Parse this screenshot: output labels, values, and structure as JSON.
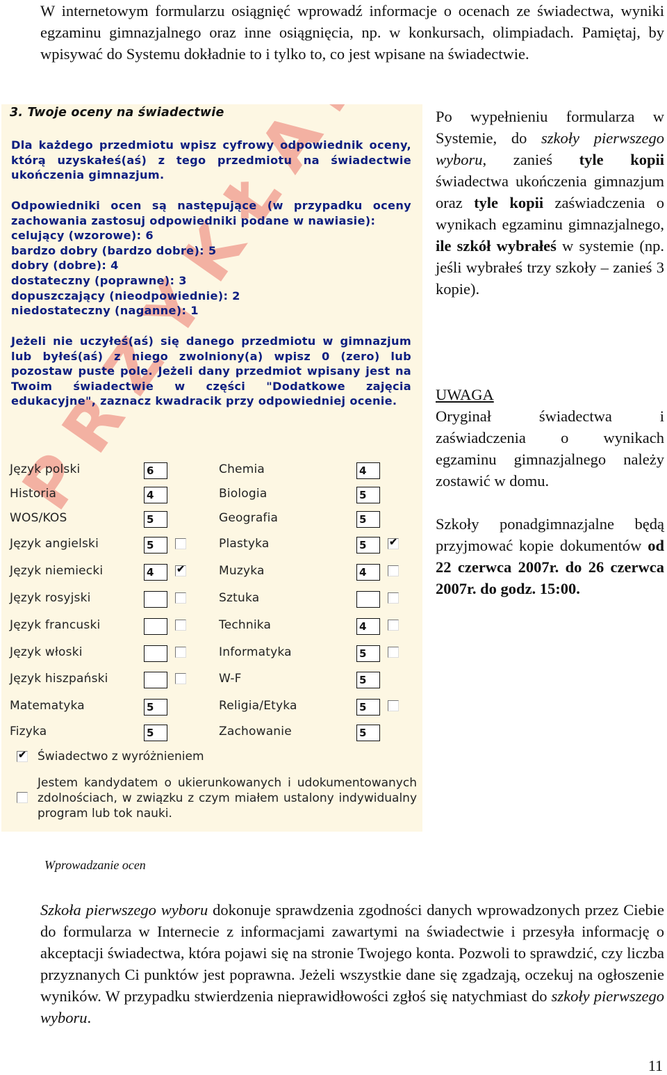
{
  "intro": {
    "text": "W internetowym formularzu osiągnięć wprowadź informacje o ocenach ze świadectwa, wyniki egzaminu gimnazjalnego oraz inne osiągnięcia, np. w konkursach, olimpiadach. Pamiętaj, by wpisywać do Systemu dokładnie to i tylko to, co jest wpisane na świadectwie."
  },
  "form": {
    "title": "3. Twoje oceny na świadectwie",
    "instruction1": "Dla każdego przedmiotu wpisz cyfrowy odpowiednik oceny, którą uzyskałeś(aś) z tego przedmiotu na świadectwie ukończenia gimnazjum.",
    "equivalents_intro": "Odpowiedniki ocen są następujące (w przypadku oceny zachowania zastosuj odpowiedniki podane w nawiasie):",
    "equivalents": [
      "celujący (wzorowe): 6",
      "bardzo dobry (bardzo dobre): 5",
      "dobry (dobre): 4",
      "dostateczny (poprawne): 3",
      "dopuszczający (nieodpowiednie): 2",
      "niedostateczny (naganne): 1"
    ],
    "instruction3": "Jeżeli nie uczyłeś(aś) się danego przedmiotu w gimnazjum lub byłeś(aś) z niego zwolniony(a) wpisz 0 (zero) lub pozostaw puste pole. Jeżeli dany przedmiot wpisany jest na Twoim świadectwie w części \"Dodatkowe zajęcia edukacyjne\", zaznacz kwadracik przy odpowiedniej ocenie.",
    "left_subjects": [
      {
        "name": "Język polski",
        "grade": "6",
        "has_checkbox": false,
        "checked": false
      },
      {
        "name": "Historia",
        "grade": "4",
        "has_checkbox": false,
        "checked": false
      },
      {
        "name": "WOS/KOS",
        "grade": "5",
        "has_checkbox": false,
        "checked": false
      },
      {
        "name": "Język angielski",
        "grade": "5",
        "has_checkbox": true,
        "checked": false
      },
      {
        "name": "Język niemiecki",
        "grade": "4",
        "has_checkbox": true,
        "checked": true
      },
      {
        "name": "Język rosyjski",
        "grade": "",
        "has_checkbox": true,
        "checked": false
      },
      {
        "name": "Język francuski",
        "grade": "",
        "has_checkbox": true,
        "checked": false
      },
      {
        "name": "Język włoski",
        "grade": "",
        "has_checkbox": true,
        "checked": false
      },
      {
        "name": "Język hiszpański",
        "grade": "",
        "has_checkbox": true,
        "checked": false
      },
      {
        "name": "Matematyka",
        "grade": "5",
        "has_checkbox": false,
        "checked": false
      },
      {
        "name": "Fizyka",
        "grade": "5",
        "has_checkbox": false,
        "checked": false
      }
    ],
    "right_subjects": [
      {
        "name": "Chemia",
        "grade": "4",
        "has_checkbox": false,
        "checked": false
      },
      {
        "name": "Biologia",
        "grade": "5",
        "has_checkbox": false,
        "checked": false
      },
      {
        "name": "Geografia",
        "grade": "5",
        "has_checkbox": false,
        "checked": false
      },
      {
        "name": "Plastyka",
        "grade": "5",
        "has_checkbox": true,
        "checked": true
      },
      {
        "name": "Muzyka",
        "grade": "4",
        "has_checkbox": true,
        "checked": false
      },
      {
        "name": "Sztuka",
        "grade": "",
        "has_checkbox": true,
        "checked": false
      },
      {
        "name": "Technika",
        "grade": "4",
        "has_checkbox": true,
        "checked": false
      },
      {
        "name": "Informatyka",
        "grade": "5",
        "has_checkbox": true,
        "checked": false
      },
      {
        "name": "W-F",
        "grade": "5",
        "has_checkbox": false,
        "checked": false
      },
      {
        "name": "Religia/Etyka",
        "grade": "5",
        "has_checkbox": true,
        "checked": false
      },
      {
        "name": "Zachowanie",
        "grade": "5",
        "has_checkbox": false,
        "checked": false
      }
    ],
    "distinction": {
      "label": "Świadectwo z wyróżnieniem",
      "checked": true
    },
    "candidate": {
      "label": "Jestem kandydatem o ukierunkowanych i udokumentowanych zdolnościach, w związku z czym miałem ustalony indywidualny program lub tok nauki.",
      "checked": false
    },
    "watermark": "PRZYKŁAD",
    "colors": {
      "instruction_text": "#0c1e80",
      "panel_bg": "#fdf7e3",
      "watermark": "#eb786e"
    }
  },
  "side": {
    "para1_parts": [
      {
        "text": "Po wypełnieniu formularza w Systemie, do ",
        "style": "normal"
      },
      {
        "text": "szkoły pierwszego wyboru",
        "style": "italic"
      },
      {
        "text": ", zanieś ",
        "style": "normal"
      },
      {
        "text": "tyle kopii",
        "style": "bold"
      },
      {
        "text": " świadectwa ukończenia gimnazjum oraz ",
        "style": "normal"
      },
      {
        "text": "tyle kopii",
        "style": "bold"
      },
      {
        "text": " zaświadczenia o wynikach egzaminu gimnazjalnego, ",
        "style": "normal"
      },
      {
        "text": "ile szkół wybrałeś",
        "style": "bold"
      },
      {
        "text": " w systemie (np. jeśli wybrałeś trzy szkoły – zanieś 3 kopie).",
        "style": "normal"
      }
    ],
    "uwaga_heading": "UWAGA",
    "uwaga_text": "Oryginał świadectwa i zaświadczenia o wynikach egzaminu gimnazjalnego należy zostawić w domu.",
    "para3_normal": "Szkoły ponadgimnazjalne będą przyjmować kopie dokumentów ",
    "para3_bold": "od 22 czerwca 2007r. do 26 czerwca 2007r. do godz. 15:00."
  },
  "caption": "Wprowadzanie ocen",
  "outro": {
    "italic_start": "Szkoła pierwszego wyboru",
    "middle": " dokonuje sprawdzenia zgodności danych wprowadzonych przez Ciebie do formularza w Internecie z informacjami zawartymi na świadectwie i przesyła informację o akceptacji świadectwa, która pojawi się na stronie Twojego konta. Pozwoli to sprawdzić, czy liczba przyznanych Ci punktów jest poprawna. Jeżeli wszystkie dane się zgadzają, oczekuj na ogłoszenie wyników. W przypadku stwierdzenia nieprawidłowości zgłoś się natychmiast do ",
    "italic_end": "szkoły pierwszego wyboru",
    "end": "."
  },
  "page_number": "11"
}
